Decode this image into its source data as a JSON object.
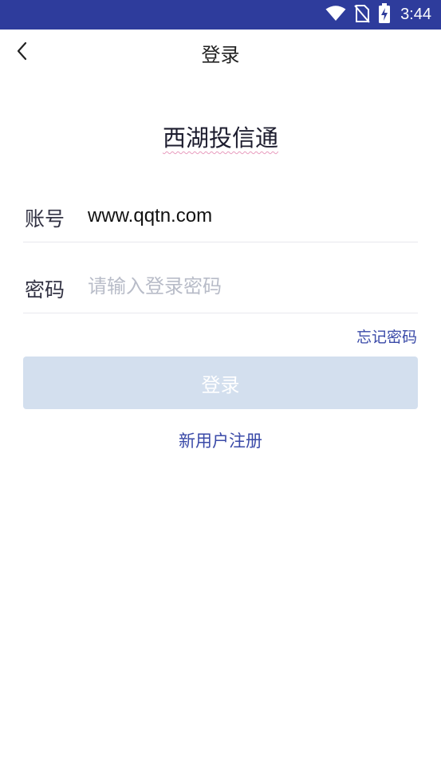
{
  "status_bar": {
    "time": "3:44",
    "icons": [
      "wifi-icon",
      "no-sim-icon",
      "battery-charging-icon"
    ]
  },
  "header": {
    "title": "登录",
    "back_icon": "chevron-left-icon"
  },
  "app": {
    "name": "西湖投信通"
  },
  "form": {
    "account": {
      "label": "账号",
      "value": "www.qqtn.com"
    },
    "password": {
      "label": "密码",
      "value": "",
      "placeholder": "请输入登录密码"
    },
    "forgot_label": "忘记密码",
    "login_label": "登录",
    "register_label": "新用户注册"
  },
  "colors": {
    "status_bar": "#2e3c9c",
    "accent": "#3a4aa8",
    "login_button_disabled": "#d3dfee"
  }
}
